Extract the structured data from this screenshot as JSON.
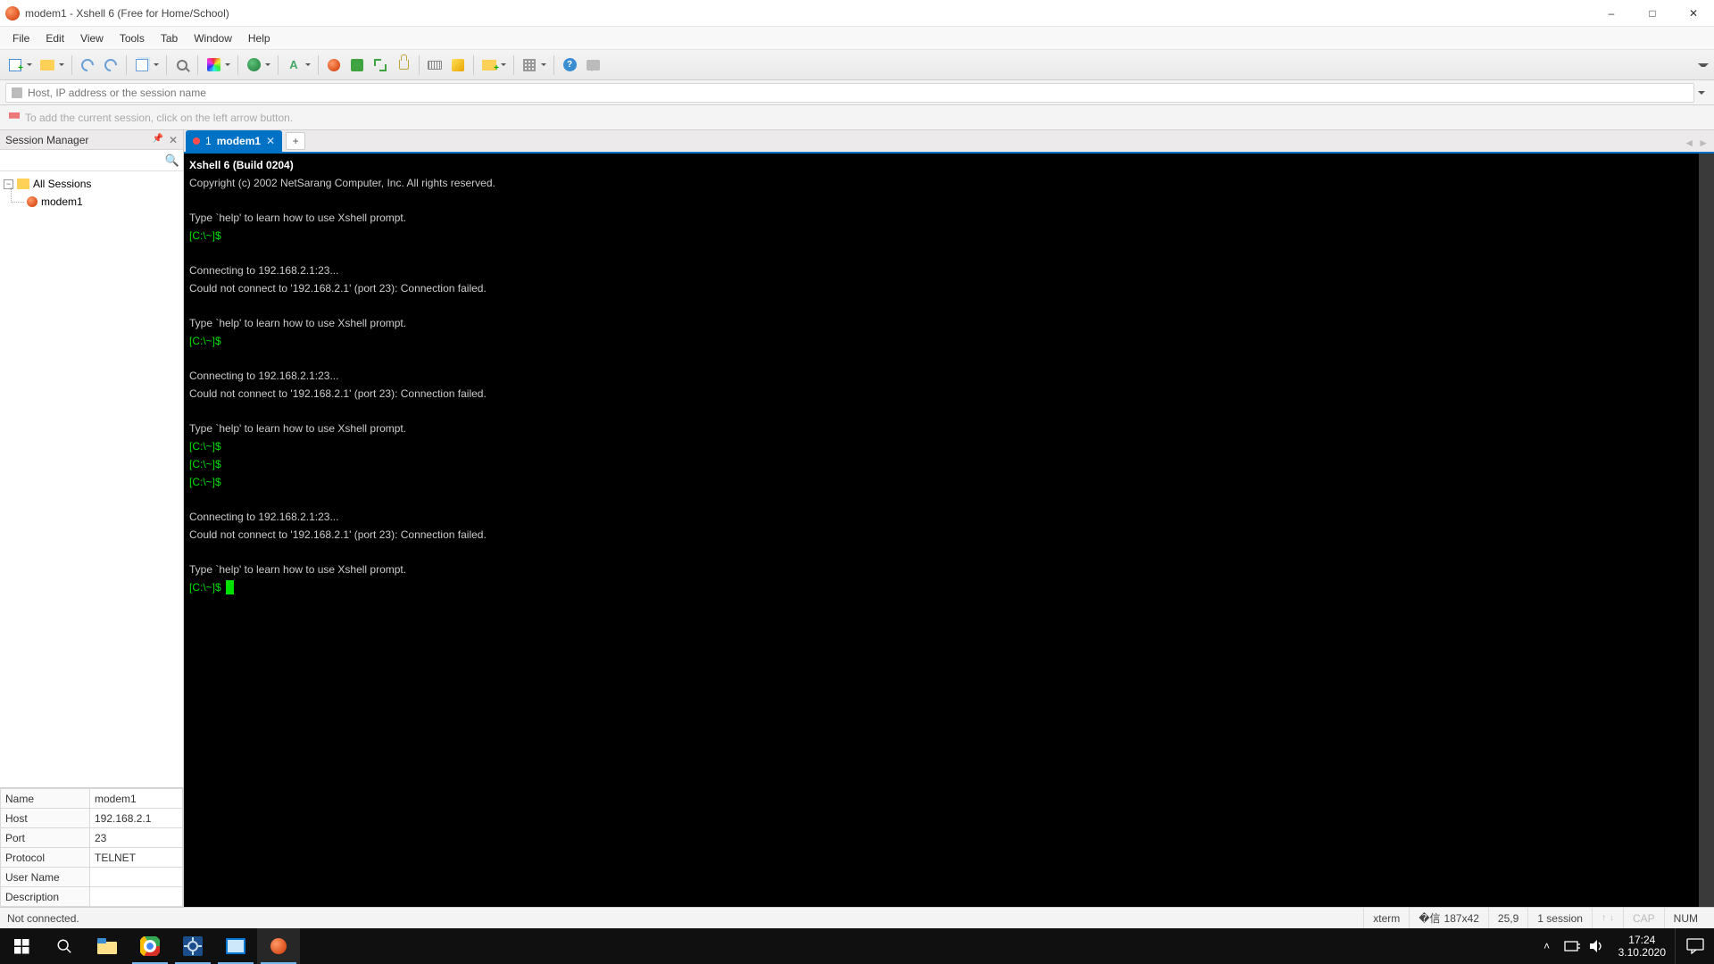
{
  "titlebar": {
    "title": "modem1 - Xshell 6 (Free for Home/School)"
  },
  "menu": [
    "File",
    "Edit",
    "View",
    "Tools",
    "Tab",
    "Window",
    "Help"
  ],
  "addressbar": {
    "placeholder": "Host, IP address or the session name"
  },
  "hint": "To add the current session, click on the left arrow button.",
  "sidebar": {
    "title": "Session Manager",
    "root": "All Sessions",
    "session": "modem1"
  },
  "props": {
    "rows": [
      {
        "k": "Name",
        "v": "modem1"
      },
      {
        "k": "Host",
        "v": "192.168.2.1"
      },
      {
        "k": "Port",
        "v": "23"
      },
      {
        "k": "Protocol",
        "v": "TELNET"
      },
      {
        "k": "User Name",
        "v": ""
      },
      {
        "k": "Description",
        "v": ""
      }
    ]
  },
  "tab": {
    "index": "1",
    "name": "modem1"
  },
  "terminal": {
    "header": "Xshell 6 (Build 0204)",
    "copyright": "Copyright (c) 2002 NetSarang Computer, Inc. All rights reserved.",
    "help": "Type `help' to learn how to use Xshell prompt.",
    "prompt": "[C:\\~]$ ",
    "connecting": "Connecting to 192.168.2.1:23...",
    "failed": "Could not connect to '192.168.2.1' (port 23): Connection failed."
  },
  "status": {
    "left": "Not connected.",
    "term": "xterm",
    "size": "187x42",
    "pos": "25,9",
    "sess": "1 session",
    "cap": "CAP",
    "num": "NUM"
  },
  "sys": {
    "time": "17:24",
    "date": "3.10.2020"
  }
}
